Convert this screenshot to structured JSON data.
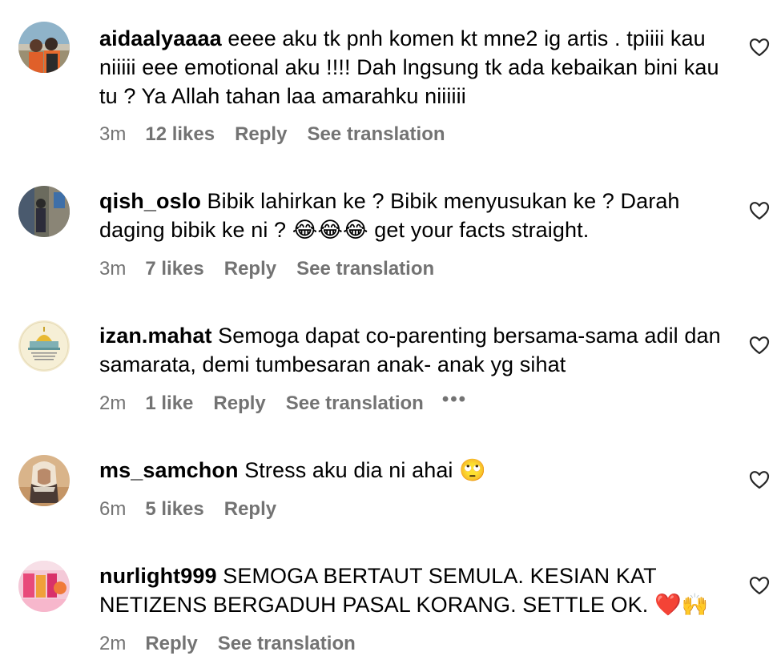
{
  "comments": [
    {
      "username": "aidaalyaaaa",
      "text": "eeee aku tk pnh komen kt mne2 ig artis . tpiiii kau niiiii eee emotional aku !!!! Dah lngsung tk ada kebaikan bini kau tu ? Ya Allah tahan laa amarahku niiiiii",
      "time": "3m",
      "likes": "12 likes",
      "reply": "Reply",
      "translate": "See translation",
      "avatar_icon": "user-avatar-photo"
    },
    {
      "username": "qish_oslo",
      "text": "Bibik lahirkan ke ? Bibik menyusukan ke ? Darah daging bibik ke ni ? 😂😂😂 get your facts straight.",
      "time": "3m",
      "likes": "7 likes",
      "reply": "Reply",
      "translate": "See translation",
      "avatar_icon": "user-avatar-photo"
    },
    {
      "username": "izan.mahat",
      "text": "Semoga dapat co-parenting bersama-sama adil dan samarata, demi tumbesaran anak- anak yg sihat",
      "time": "2m",
      "likes": "1 like",
      "reply": "Reply",
      "translate": "See translation",
      "more": "•••",
      "avatar_icon": "user-avatar-mosque"
    },
    {
      "username": "ms_samchon",
      "text": "Stress aku dia ni ahai 🙄",
      "time": "6m",
      "likes": "5 likes",
      "reply": "Reply",
      "avatar_icon": "user-avatar-photo"
    },
    {
      "username": "nurlight999",
      "text": "SEMOGA BERTAUT SEMULA. KESIAN KAT NETIZENS BERGADUH PASAL KORANG. SETTLE OK. ❤️🙌",
      "time": "2m",
      "reply": "Reply",
      "translate": "See translation",
      "avatar_icon": "user-avatar-photo"
    }
  ],
  "icons": {
    "like": "heart-outline-icon",
    "more": "more-options-icon"
  },
  "colors": {
    "text": "#000000",
    "meta": "#737373",
    "background": "#ffffff"
  }
}
